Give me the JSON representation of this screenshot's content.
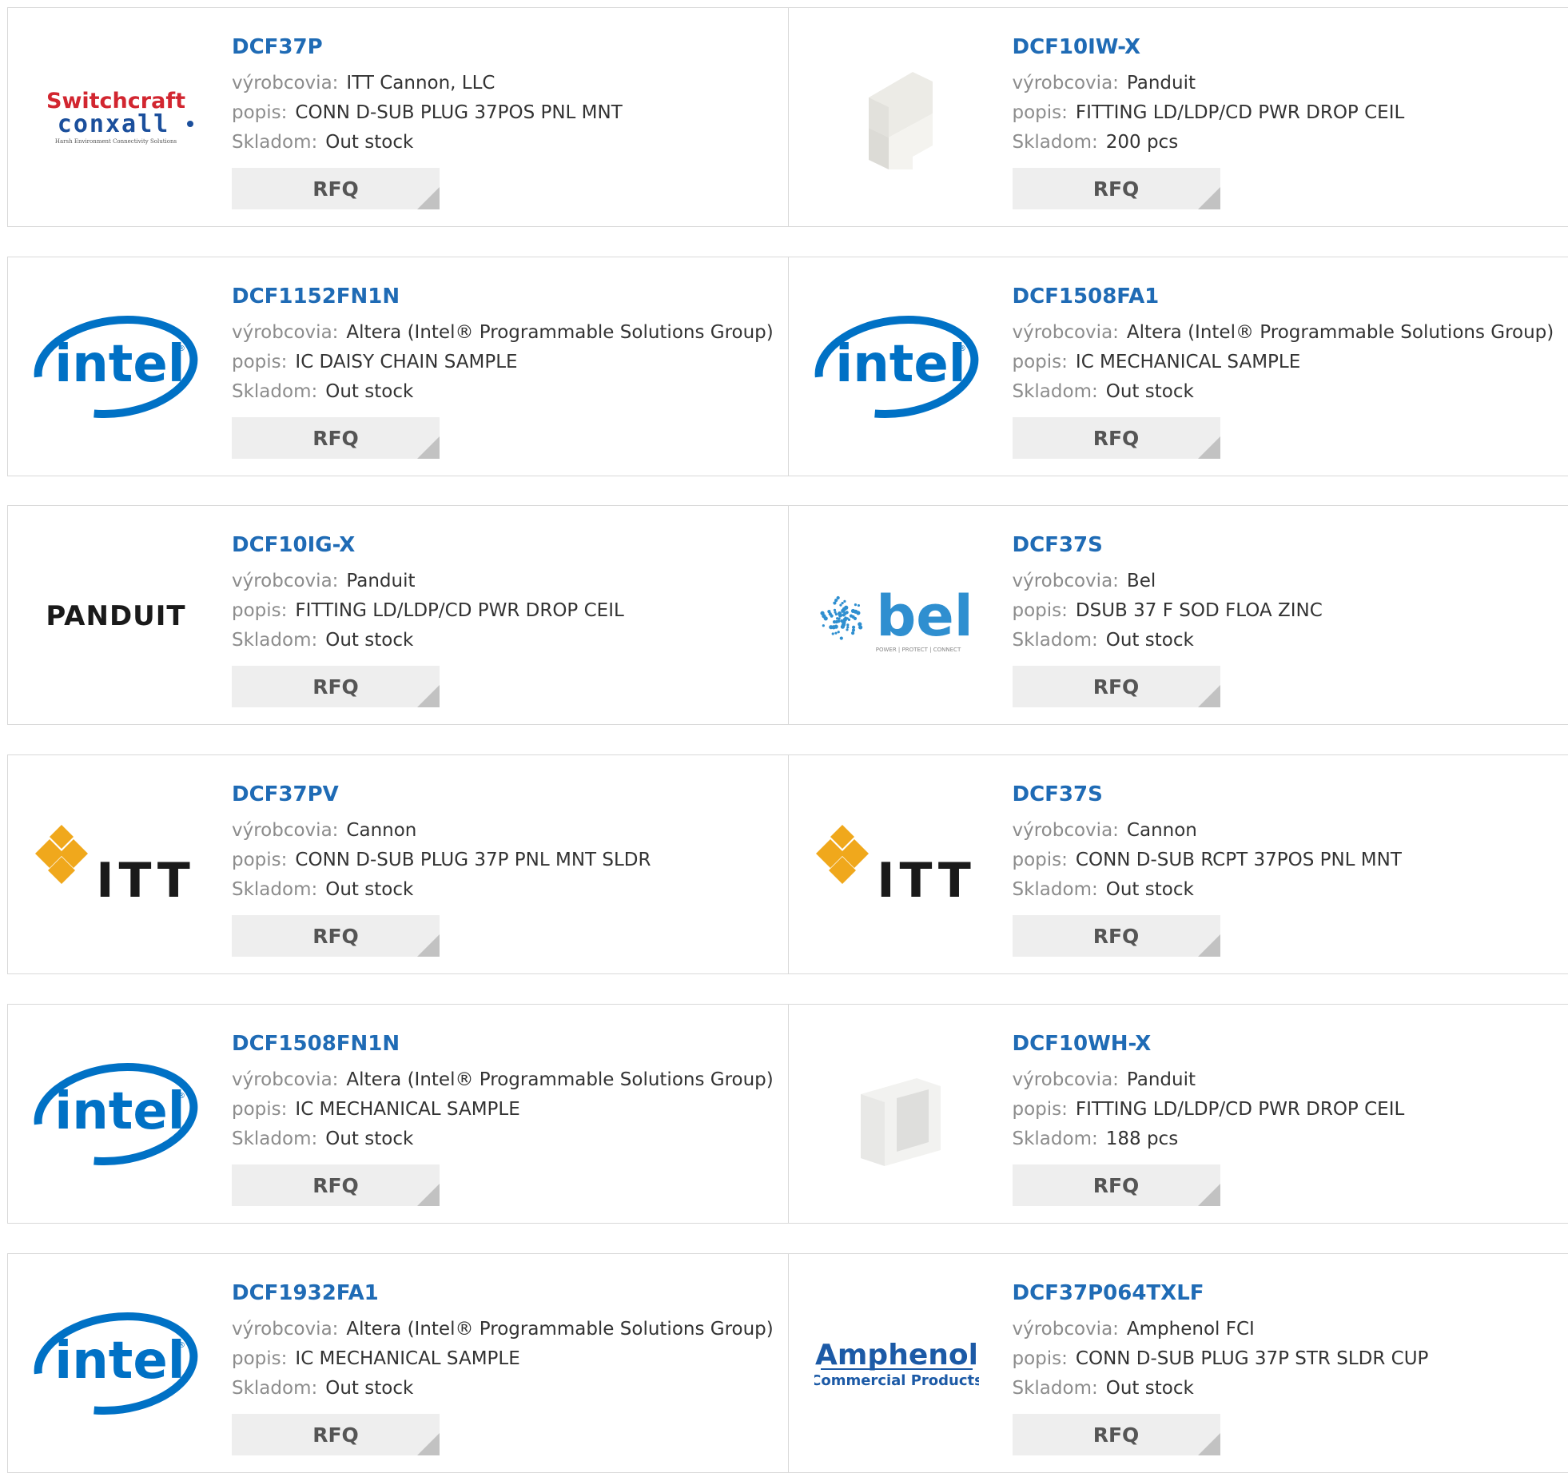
{
  "labels": {
    "manufacturer": "výrobcovia:",
    "description": "popis:",
    "stock": "Skladom:",
    "rfq": "RFQ"
  },
  "products": [
    {
      "part_number": "DCF37P",
      "manufacturer": "ITT Cannon, LLC",
      "description": "CONN D-SUB PLUG 37POS PNL MNT",
      "stock": "Out stock",
      "logo": "switchcraft-conxall",
      "logo_text": [
        "Switchcraft",
        "conxall",
        "Harsh Environment Connectivity Solutions"
      ]
    },
    {
      "part_number": "DCF10IW-X",
      "manufacturer": "Panduit",
      "description": "FITTING LD/LDP/CD PWR DROP CEIL",
      "stock": "200 pcs",
      "logo": "product-photo-ceiling-drop"
    },
    {
      "part_number": "DCF1152FN1N",
      "manufacturer": "Altera (Intel® Programmable Solutions Group)",
      "description": "IC DAISY CHAIN SAMPLE",
      "stock": "Out stock",
      "logo": "intel",
      "logo_text": [
        "intel"
      ]
    },
    {
      "part_number": "DCF1508FA1",
      "manufacturer": "Altera (Intel® Programmable Solutions Group)",
      "description": "IC MECHANICAL SAMPLE",
      "stock": "Out stock",
      "logo": "intel",
      "logo_text": [
        "intel"
      ]
    },
    {
      "part_number": "DCF10IG-X",
      "manufacturer": "Panduit",
      "description": "FITTING LD/LDP/CD PWR DROP CEIL",
      "stock": "Out stock",
      "logo": "panduit",
      "logo_text": [
        "PANDUIT"
      ]
    },
    {
      "part_number": "DCF37S",
      "manufacturer": "Bel",
      "description": "DSUB 37 F SOD FLOA ZINC",
      "stock": "Out stock",
      "logo": "bel",
      "logo_text": [
        "bel",
        "POWER | PROTECT | CONNECT"
      ]
    },
    {
      "part_number": "DCF37PV",
      "manufacturer": "Cannon",
      "description": "CONN D-SUB PLUG 37P PNL MNT SLDR",
      "stock": "Out stock",
      "logo": "itt",
      "logo_text": [
        "ITT"
      ]
    },
    {
      "part_number": "DCF37S",
      "manufacturer": "Cannon",
      "description": "CONN D-SUB RCPT 37POS PNL MNT",
      "stock": "Out stock",
      "logo": "itt",
      "logo_text": [
        "ITT"
      ]
    },
    {
      "part_number": "DCF1508FN1N",
      "manufacturer": "Altera (Intel® Programmable Solutions Group)",
      "description": "IC MECHANICAL SAMPLE",
      "stock": "Out stock",
      "logo": "intel",
      "logo_text": [
        "intel"
      ]
    },
    {
      "part_number": "DCF10WH-X",
      "manufacturer": "Panduit",
      "description": "FITTING LD/LDP/CD PWR DROP CEIL",
      "stock": "188 pcs",
      "logo": "product-photo-end-cap"
    },
    {
      "part_number": "DCF1932FA1",
      "manufacturer": "Altera (Intel® Programmable Solutions Group)",
      "description": "IC MECHANICAL SAMPLE",
      "stock": "Out stock",
      "logo": "intel",
      "logo_text": [
        "intel"
      ]
    },
    {
      "part_number": "DCF37P064TXLF",
      "manufacturer": "Amphenol FCI",
      "description": "CONN D-SUB PLUG 37P STR SLDR CUP",
      "stock": "Out stock",
      "logo": "amphenol",
      "logo_text": [
        "Amphenol",
        "Commercial Products"
      ]
    }
  ],
  "colors": {
    "part_number": "#1f6bb5",
    "label": "#8c8c8c",
    "value": "#333333",
    "rfq_bg": "#eeeeee",
    "intel_blue": "#0071c5",
    "switchcraft_red": "#d22630",
    "conxall_blue": "#1b4f9c",
    "itt_gold": "#f0a81c",
    "bel_blue": "#2f8fd0"
  }
}
